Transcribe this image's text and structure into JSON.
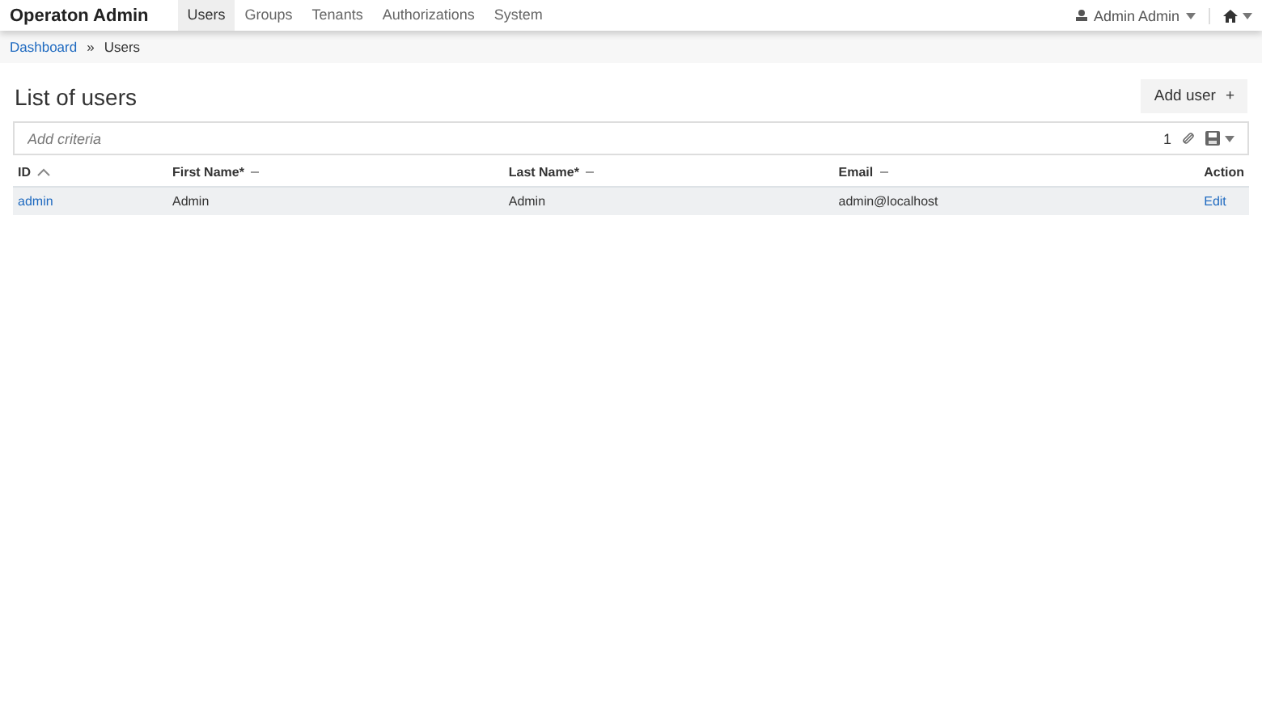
{
  "navbar": {
    "brand": "Operaton Admin",
    "tabs": [
      {
        "label": "Users",
        "selected": true
      },
      {
        "label": "Groups",
        "selected": false
      },
      {
        "label": "Tenants",
        "selected": false
      },
      {
        "label": "Authorizations",
        "selected": false
      },
      {
        "label": "System",
        "selected": false
      }
    ],
    "user": "Admin Admin"
  },
  "breadcrumb": [
    {
      "label": "Dashboard",
      "kind": "link"
    },
    {
      "label": "»",
      "kind": "separator"
    },
    {
      "label": "Users",
      "kind": "current"
    }
  ],
  "page": {
    "title": "List of users",
    "add_button": "Add user",
    "add_icon": "+"
  },
  "search": {
    "placeholder": "Add criteria",
    "count": "1"
  },
  "table": {
    "columns": [
      {
        "label": "ID",
        "kind": "ascending"
      },
      {
        "label": "First Name*",
        "kind": "sortable"
      },
      {
        "label": "Last Name*",
        "kind": "sortable"
      },
      {
        "label": "Email",
        "kind": "sortable"
      },
      {
        "label": "Action",
        "kind": "plain"
      }
    ],
    "rows": [
      {
        "cells": [
          "admin",
          "Admin",
          "Admin",
          "admin@localhost",
          "Edit"
        ]
      }
    ]
  }
}
